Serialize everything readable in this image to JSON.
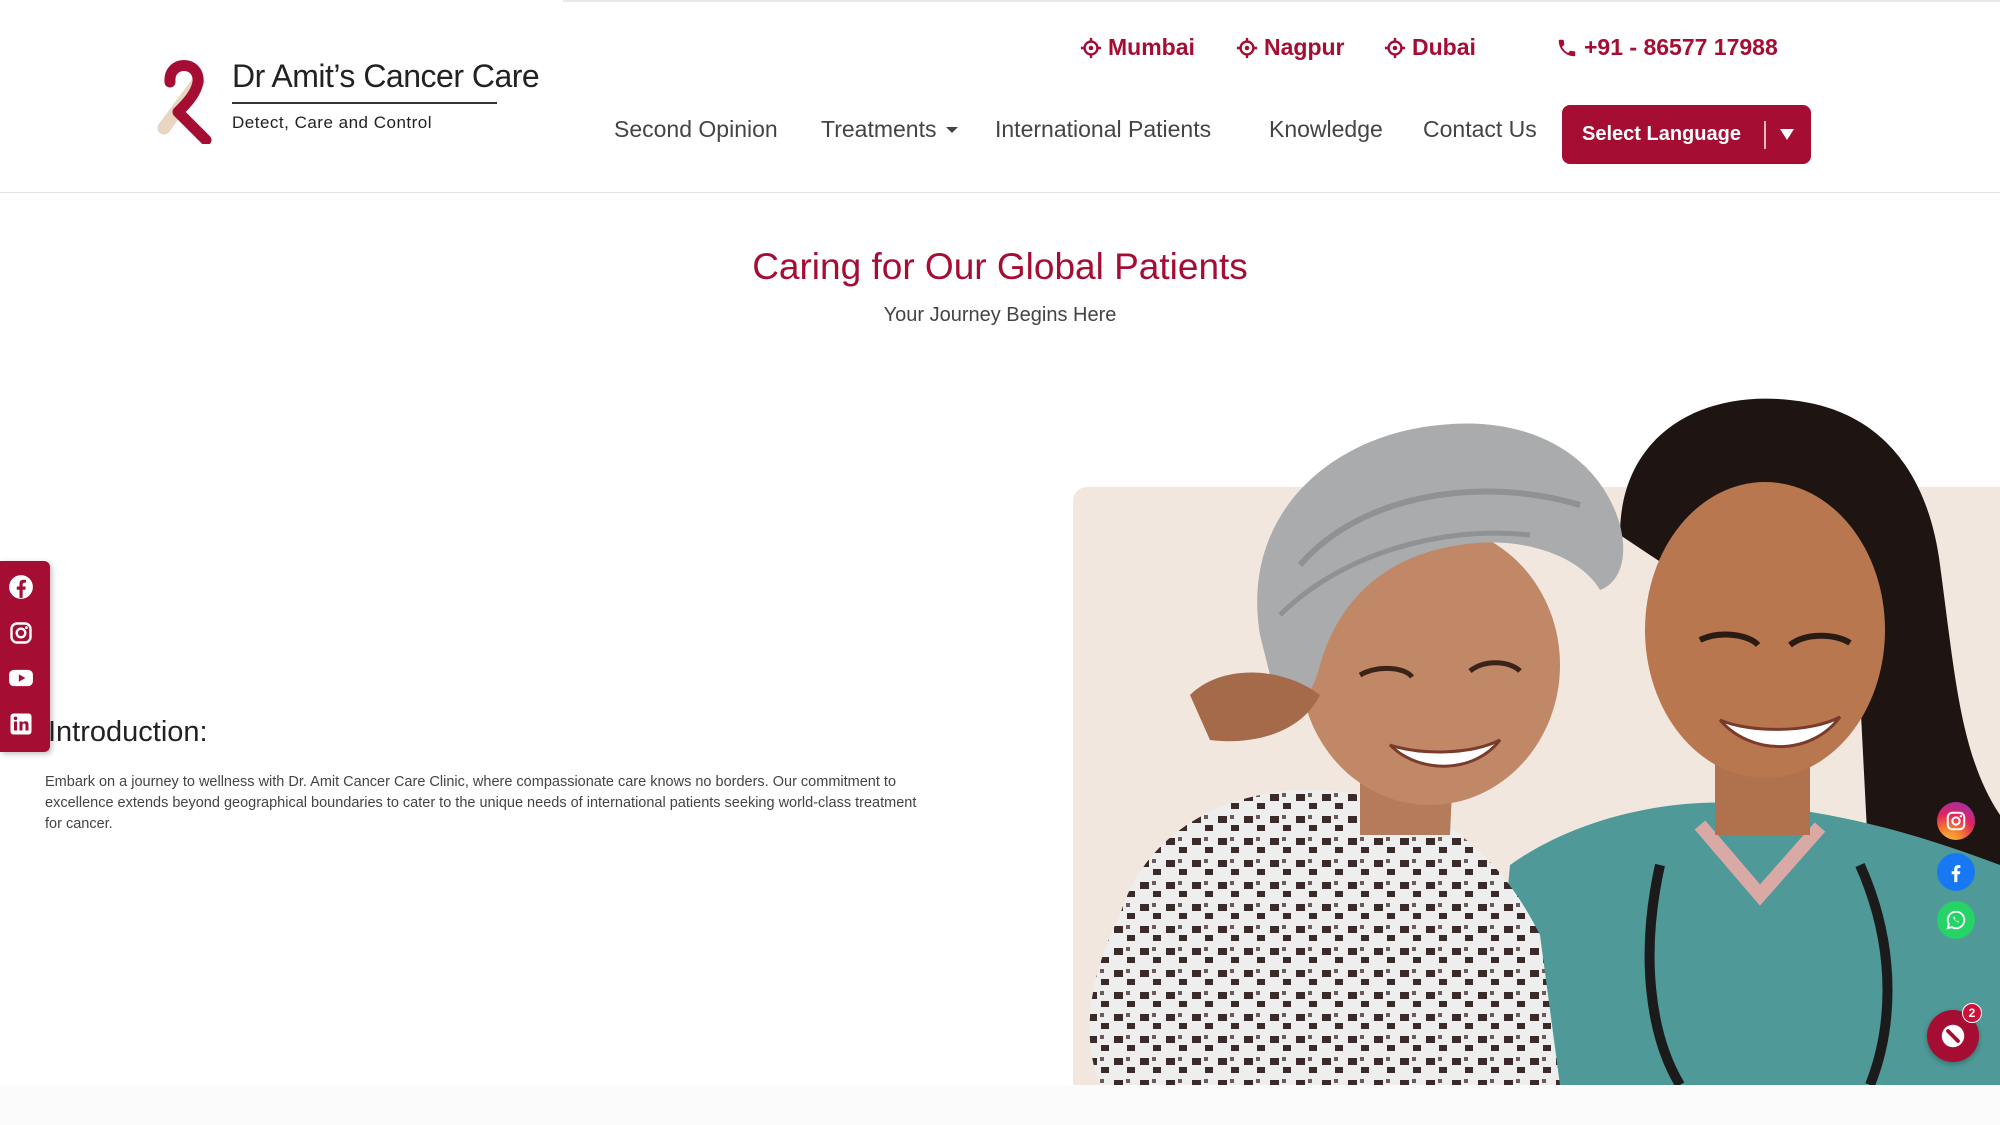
{
  "brand": {
    "name": "Dr Amit’s Cancer Care",
    "tagline": "Detect, Care and Control"
  },
  "locations": [
    "Mumbai",
    "Nagpur",
    "Dubai"
  ],
  "phone": "+91 - 86577 17988",
  "nav": {
    "second_opinion": "Second Opinion",
    "treatments": "Treatments",
    "international": "International Patients",
    "knowledge": "Knowledge",
    "contact": "Contact Us"
  },
  "language_button": "Select Language",
  "hero": {
    "title": "Caring for Our Global Patients",
    "subtitle": "Your Journey Begins Here"
  },
  "intro": {
    "heading": "Introduction:",
    "text": "Embark on a journey to wellness with Dr. Amit Cancer Care Clinic, where compassionate care knows no borders. Our commitment to excellence extends beyond geographical boundaries to cater to the unique needs of international patients seeking world-class treatment for cancer."
  },
  "social_left": [
    "facebook-icon",
    "instagram-icon",
    "youtube-icon",
    "linkedin-icon"
  ],
  "social_right": [
    "instagram-icon",
    "facebook-icon",
    "whatsapp-icon"
  ],
  "chat_badge": "2",
  "colors": {
    "brand": "#a50d33",
    "text": "#444444",
    "photo_bg": "#f2e7df"
  }
}
